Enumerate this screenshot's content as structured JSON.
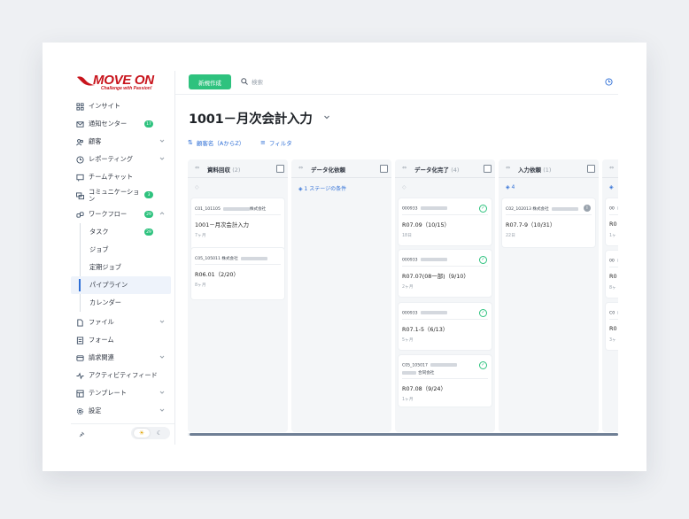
{
  "brand": {
    "name": "MOVE ON",
    "tagline": "Challenge with Passion!",
    "color": "#c8141c"
  },
  "accent": "#2f6fd6",
  "success": "#2ec27e",
  "sidebar": {
    "items": [
      {
        "label": "インサイト",
        "icon": "grid-icon"
      },
      {
        "label": "通知センター",
        "icon": "mail-icon",
        "badge": "17"
      },
      {
        "label": "顧客",
        "icon": "users-icon"
      },
      {
        "label": "レポーティング",
        "icon": "clock-icon"
      },
      {
        "label": "チームチャット",
        "icon": "chat-icon"
      },
      {
        "label": "コミュニケーション",
        "icon": "message-icon",
        "badge": "3"
      },
      {
        "label": "ワークフロー",
        "icon": "link-icon",
        "badge": "29"
      },
      {
        "label": "ファイル",
        "icon": "file-icon"
      },
      {
        "label": "フォーム",
        "icon": "form-icon"
      },
      {
        "label": "請求関連",
        "icon": "billing-icon"
      },
      {
        "label": "アクティビティフィード",
        "icon": "activity-icon"
      },
      {
        "label": "テンプレート",
        "icon": "template-icon"
      },
      {
        "label": "設定",
        "icon": "gear-icon"
      }
    ],
    "workflow_sub": [
      {
        "label": "タスク",
        "badge": "29"
      },
      {
        "label": "ジョブ"
      },
      {
        "label": "定期ジョブ"
      },
      {
        "label": "パイプライン"
      },
      {
        "label": "カレンダー"
      }
    ],
    "mode_light": "☀",
    "mode_dark": "☾"
  },
  "topbar": {
    "new_label": "新規作成",
    "search_placeholder": "検索"
  },
  "page": {
    "title": "1001－月次会計入力",
    "sort_label": "顧客名（AからZ）",
    "filter_label": "フィルタ"
  },
  "columns": [
    {
      "name": "資料回収",
      "count": "(2)",
      "sub": "◇",
      "sub_style": "gray",
      "cards": [
        {
          "id": "C01_101105",
          "id_suffix": "株式会社",
          "name": "1001－月次会計入力",
          "age": "7ヶ月",
          "status": "none"
        },
        {
          "id": "C05_105011 株式会社",
          "id_suffix": "",
          "name": "R06.01（2/20）",
          "age": "8ヶ月",
          "status": "none"
        }
      ]
    },
    {
      "name": "データ化依頼",
      "count": "",
      "sub": "◈ 1  ステージの条件",
      "sub_style": "blue",
      "cards": []
    },
    {
      "name": "データ化完了",
      "count": "(4)",
      "sub": "◇",
      "sub_style": "gray",
      "cards": [
        {
          "id": "000933",
          "id_suffix": "",
          "name": "R07.09（10/15）",
          "age": "18日",
          "status": "ok"
        },
        {
          "id": "000933",
          "id_suffix": "",
          "name": "R07.07(08一部)（9/10）",
          "age": "2ヶ月",
          "status": "ok"
        },
        {
          "id": "000933",
          "id_suffix": "",
          "name": "R07.1-5（6/13）",
          "age": "5ヶ月",
          "status": "ok"
        },
        {
          "id": "C05_105017",
          "id_suffix": "合同会社",
          "name": "R07.08（9/24）",
          "age": "1ヶ月",
          "status": "ok"
        }
      ]
    },
    {
      "name": "入力依頼",
      "count": "(1)",
      "sub": "◈ 4",
      "sub_style": "blue",
      "cards": [
        {
          "id": "C02_102013 株式会社",
          "id_suffix": "",
          "name": "R07.7-9（10/31）",
          "age": "22日",
          "status": "info"
        }
      ]
    },
    {
      "name": "",
      "count": "",
      "sub": "◈",
      "sub_style": "blue",
      "cards": [
        {
          "id": "00",
          "id_suffix": "",
          "name": "R0",
          "age": "1ヶ",
          "status": "none"
        },
        {
          "id": "00",
          "id_suffix": "",
          "name": "R0",
          "age": "8ヶ",
          "status": "none"
        },
        {
          "id": "C0",
          "id_suffix": "",
          "name": "R0",
          "age": "3ヶ",
          "status": "none"
        }
      ]
    }
  ]
}
